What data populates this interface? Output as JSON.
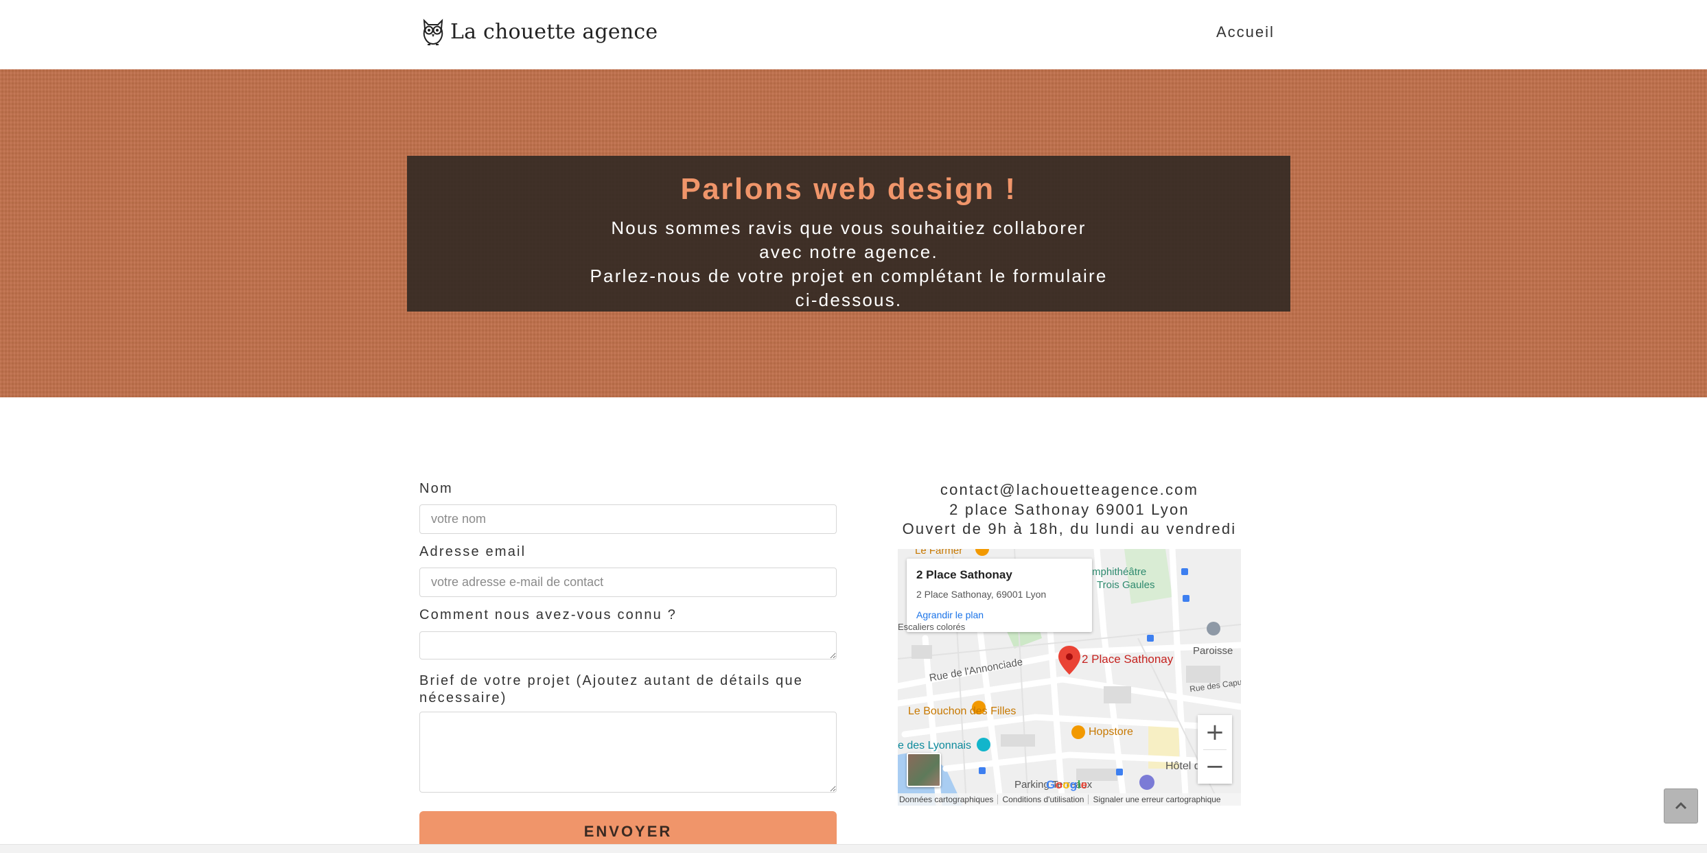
{
  "header": {
    "brand": "La chouette agence",
    "nav_home": "Accueil"
  },
  "hero": {
    "title": "Parlons web design !",
    "line1": "Nous sommes ravis que vous souhaitiez collaborer avec notre agence.",
    "line2": "Parlez-nous de votre projet en complétant le formulaire ci-dessous."
  },
  "form": {
    "name_label": "Nom",
    "name_placeholder": "votre nom",
    "email_label": "Adresse email",
    "email_placeholder": "votre adresse e-mail de contact",
    "source_label": "Comment nous avez-vous connu ?",
    "brief_label": "Brief de votre projet (Ajoutez autant de détails que nécessaire)",
    "submit_label": "ENVOYER"
  },
  "contact": {
    "email": "contact@lachouetteagence.com",
    "address": "2 place Sathonay 69001 Lyon",
    "hours": "Ouvert de 9h à 18h, du lundi au vendredi"
  },
  "map": {
    "card_title": "2 Place Sathonay",
    "card_address": "2 Place Sathonay, 69001 Lyon",
    "card_link": "Agrandir le plan",
    "pin_label": "2 Place Sathonay",
    "labels": {
      "le_farmer": "Le Farmer",
      "amphitheatre": "mphithéâtre",
      "trois_gaules": "Trois Gaules",
      "escaliers": "Escaliers colorés",
      "paroisse": "Paroisse",
      "annonciade": "Rue de l'Annonciade",
      "capucins": "Rue des Capu",
      "bouchon": "Le Bouchon des Filles",
      "hopstore": "Hopstore",
      "lyonnais": "e des Lyonnais",
      "hotel": "Hôtel d",
      "parking": "Parking Terreaux"
    },
    "zoom_in": "+",
    "zoom_out": "−",
    "google": "Google",
    "footer": [
      "Données cartographiques",
      "Conditions d'utilisation",
      "Signaler une erreur cartographique"
    ]
  },
  "icons": {
    "logo": "owl-icon",
    "scroll_top": "chevron-up-icon"
  },
  "colors": {
    "accent": "#f0956a",
    "hero_bg": "#c0704a",
    "hero_box": "#342a24"
  }
}
